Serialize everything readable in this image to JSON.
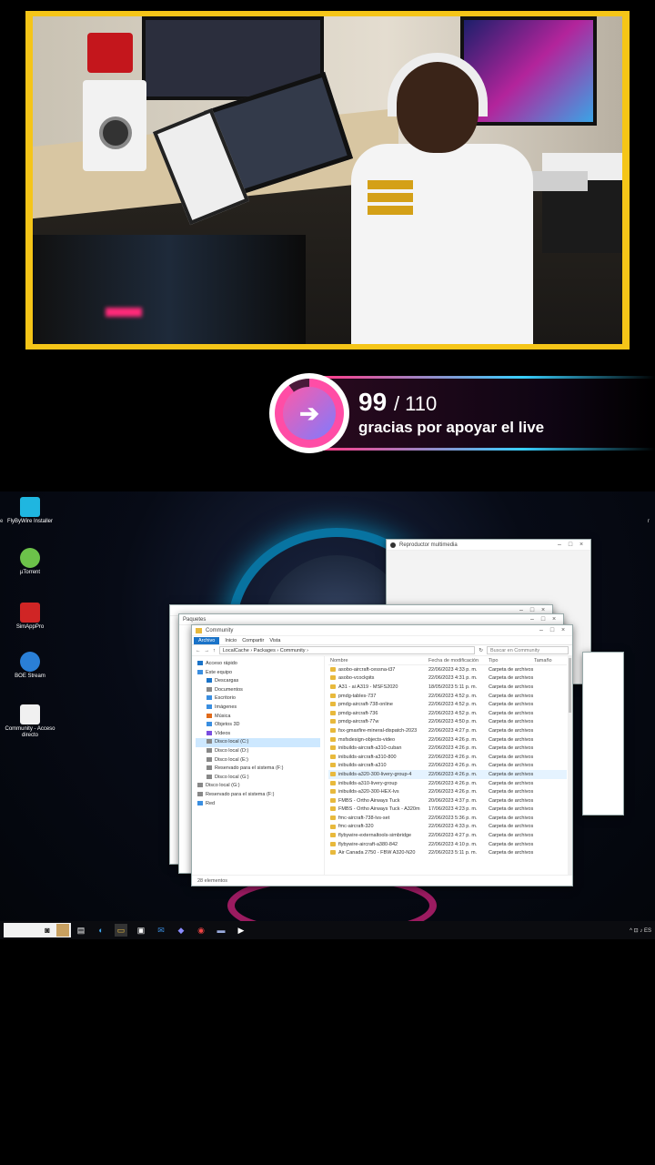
{
  "stream_goal": {
    "current": "99",
    "total": "/ 110",
    "message": "gracias por apoyar el live",
    "progress_percent": 90,
    "accent_color": "#ff4da6"
  },
  "desktop_icons": [
    {
      "label": "FlyByWire Installer",
      "color": "#1fb6e0"
    },
    {
      "label": "µTorrent",
      "color": "#6cc24a"
    },
    {
      "label": "SimAppPro",
      "color": "#d02525"
    },
    {
      "label": "BOE Stream",
      "color": "#2a7fd6"
    },
    {
      "label": "Community - Acceso directo",
      "color": "#f0f0f0"
    }
  ],
  "media_player": {
    "title": "Reproductor multimedia"
  },
  "explorer": {
    "title": "Community",
    "back_title_1": "Paquetes",
    "ribbon": [
      "Archivo",
      "Inicio",
      "Compartir",
      "Vista"
    ],
    "path": "LocalCache  ›  Packages  ›  Community  ›",
    "search_placeholder": "Buscar en Community",
    "columns": {
      "name": "Nombre",
      "date": "Fecha de modificación",
      "type": "Tipo",
      "size": "Tamaño"
    },
    "nav_items": [
      {
        "label": "Acceso rápido",
        "icon_color": "#1a73c8"
      },
      {
        "label": "Este equipo",
        "icon_color": "#3a8ee0"
      },
      {
        "label": "Descargas",
        "icon_color": "#1a73c8"
      },
      {
        "label": "Documentos",
        "icon_color": "#888"
      },
      {
        "label": "Escritorio",
        "icon_color": "#3a8ee0"
      },
      {
        "label": "Imágenes",
        "icon_color": "#3a8ee0"
      },
      {
        "label": "Música",
        "icon_color": "#e06a1a"
      },
      {
        "label": "Objetos 3D",
        "icon_color": "#3a8ee0"
      },
      {
        "label": "Vídeos",
        "icon_color": "#7a4ee0"
      },
      {
        "label": "Disco local (C:)",
        "icon_color": "#888"
      },
      {
        "label": "Disco local (D:)",
        "icon_color": "#888"
      },
      {
        "label": "Disco local (E:)",
        "icon_color": "#888"
      },
      {
        "label": "Reservado para el sistema (F:)",
        "icon_color": "#888"
      },
      {
        "label": "Disco local (G:)",
        "icon_color": "#888"
      },
      {
        "label": "Disco local (G:)",
        "icon_color": "#888"
      },
      {
        "label": "Reservado para el sistema (F:)",
        "icon_color": "#888"
      },
      {
        "label": "Red",
        "icon_color": "#3a8ee0"
      }
    ],
    "rows": [
      {
        "name": "asobo-aircraft-cessna-t37",
        "date": "22/06/2023 4:33 p. m.",
        "type": "Carpeta de archivos"
      },
      {
        "name": "asobo-vcockpits",
        "date": "22/06/2023 4:31 p. m.",
        "type": "Carpeta de archivos"
      },
      {
        "name": "A31 - ai A319 - MSFS2020",
        "date": "18/05/2023 5:11 p. m.",
        "type": "Carpeta de archivos"
      },
      {
        "name": "pmdg-tables-737",
        "date": "22/06/2023 4:52 p. m.",
        "type": "Carpeta de archivos"
      },
      {
        "name": "pmdg-aircraft-738-online",
        "date": "22/06/2023 4:52 p. m.",
        "type": "Carpeta de archivos"
      },
      {
        "name": "pmdg-aircraft-736",
        "date": "22/06/2023 4:52 p. m.",
        "type": "Carpeta de archivos"
      },
      {
        "name": "pmdg-aircraft-77w",
        "date": "22/06/2023 4:50 p. m.",
        "type": "Carpeta de archivos"
      },
      {
        "name": "fsx-gmaxfire-mineral-dispatch-2023",
        "date": "22/06/2023 4:27 p. m.",
        "type": "Carpeta de archivos"
      },
      {
        "name": "msfsdesign-objects-video",
        "date": "22/06/2023 4:26 p. m.",
        "type": "Carpeta de archivos"
      },
      {
        "name": "inibuilds-aircraft-a310-cuban",
        "date": "22/06/2023 4:26 p. m.",
        "type": "Carpeta de archivos"
      },
      {
        "name": "inibuilds-aircraft-a310-800",
        "date": "22/06/2023 4:26 p. m.",
        "type": "Carpeta de archivos"
      },
      {
        "name": "inibuilds-aircraft-a310",
        "date": "22/06/2023 4:26 p. m.",
        "type": "Carpeta de archivos"
      },
      {
        "name": "inibuilds-a320-300-livery-group-4",
        "date": "22/06/2023 4:26 p. m.",
        "type": "Carpeta de archivos"
      },
      {
        "name": "inibuilds-a310-livery-group",
        "date": "22/06/2023 4:26 p. m.",
        "type": "Carpeta de archivos"
      },
      {
        "name": "inibuilds-a320-300-HEX-lvs",
        "date": "22/06/2023 4:26 p. m.",
        "type": "Carpeta de archivos"
      },
      {
        "name": "FMBS - Ortho Airways Tuck",
        "date": "20/06/2023 4:37 p. m.",
        "type": "Carpeta de archivos"
      },
      {
        "name": "FMBS - Ortho Airways Tuck - A320m",
        "date": "17/06/2023 4:23 p. m.",
        "type": "Carpeta de archivos"
      },
      {
        "name": "fmc-aircraft-738-lvs-set",
        "date": "22/06/2023 5:36 p. m.",
        "type": "Carpeta de archivos"
      },
      {
        "name": "fmc-aircraft-320",
        "date": "22/06/2023 4:33 p. m.",
        "type": "Carpeta de archivos"
      },
      {
        "name": "flybywire-externaltools-simbridge",
        "date": "22/06/2023 4:27 p. m.",
        "type": "Carpeta de archivos"
      },
      {
        "name": "flybywire-aircraft-a380-842",
        "date": "22/06/2023 4:10 p. m.",
        "type": "Carpeta de archivos"
      },
      {
        "name": "Air Canada 2750 - FBW A320-N20",
        "date": "22/06/2023 5:11 p. m.",
        "type": "Carpeta de archivos"
      }
    ],
    "status": "28 elementos"
  },
  "taskbar": {
    "tray_text": "^  ⊡  ♪  ES"
  }
}
